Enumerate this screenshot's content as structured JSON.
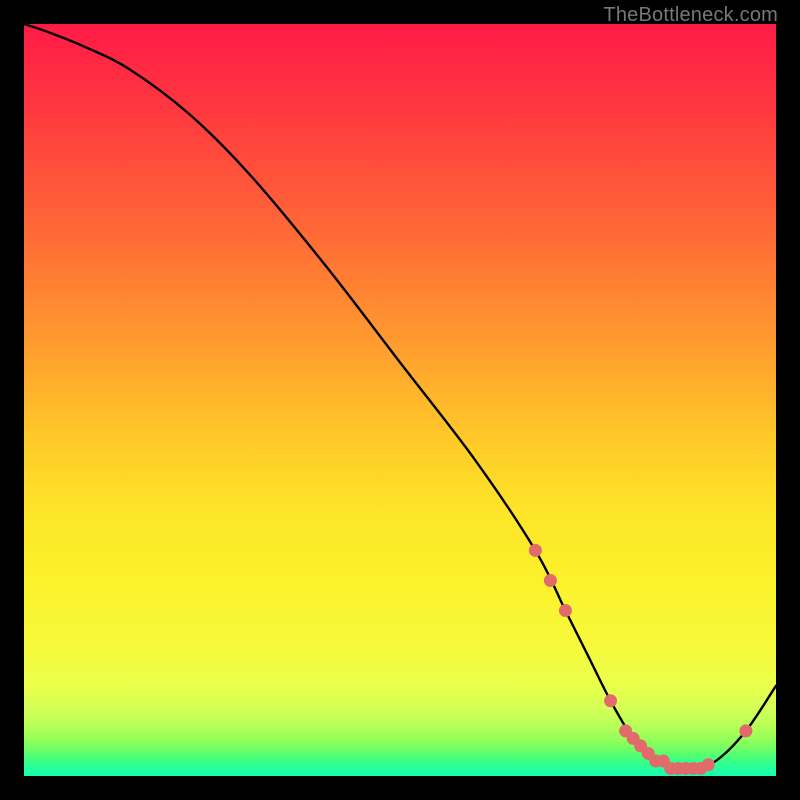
{
  "attribution": "TheBottleneck.com",
  "colors": {
    "background": "#000000",
    "gradient_top": "#ff1a46",
    "gradient_mid1": "#ff9a2f",
    "gradient_mid2": "#fbf22a",
    "gradient_bottom": "#13ffb4",
    "curve": "#000000",
    "marker": "#e36a6a"
  },
  "chart_data": {
    "type": "line",
    "title": "",
    "xlabel": "",
    "ylabel": "",
    "xlim": [
      0,
      100
    ],
    "ylim": [
      0,
      100
    ],
    "series": [
      {
        "name": "curve",
        "x": [
          0,
          3,
          8,
          14,
          22,
          30,
          40,
          50,
          60,
          68,
          72,
          75,
          78,
          81,
          84,
          87,
          89,
          92,
          96,
          100
        ],
        "values": [
          100,
          99,
          97,
          94,
          88,
          80,
          68,
          55,
          42,
          30,
          22,
          16,
          10,
          5,
          2,
          1,
          1,
          2,
          6,
          12
        ]
      }
    ],
    "markers": [
      {
        "x": 68,
        "y": 30
      },
      {
        "x": 70,
        "y": 26
      },
      {
        "x": 72,
        "y": 22
      },
      {
        "x": 78,
        "y": 10
      },
      {
        "x": 80,
        "y": 6
      },
      {
        "x": 81,
        "y": 5
      },
      {
        "x": 82,
        "y": 4
      },
      {
        "x": 83,
        "y": 3
      },
      {
        "x": 84,
        "y": 2
      },
      {
        "x": 85,
        "y": 2
      },
      {
        "x": 86,
        "y": 1
      },
      {
        "x": 87,
        "y": 1
      },
      {
        "x": 88,
        "y": 1
      },
      {
        "x": 89,
        "y": 1
      },
      {
        "x": 90,
        "y": 1
      },
      {
        "x": 91,
        "y": 1.5
      },
      {
        "x": 96,
        "y": 6
      }
    ],
    "annotations": []
  }
}
